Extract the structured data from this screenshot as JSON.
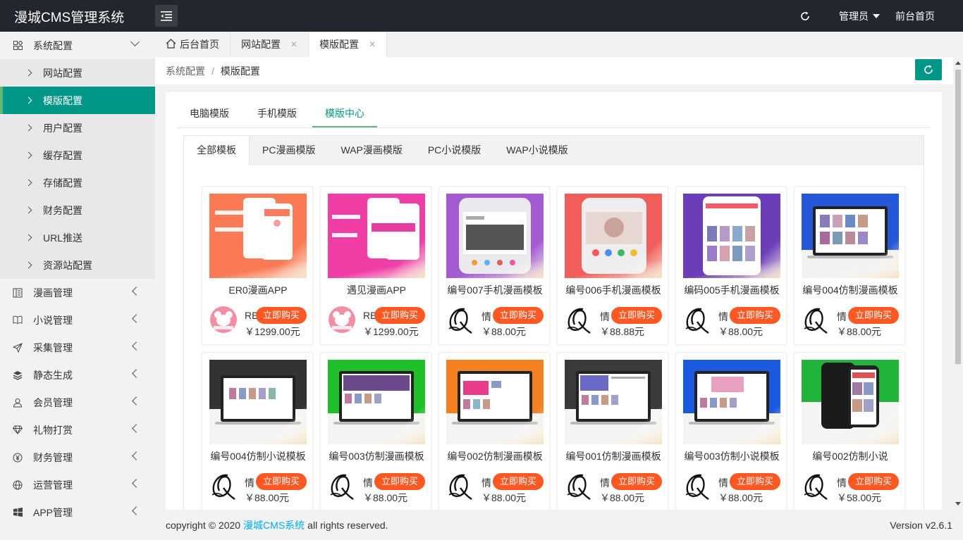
{
  "app": {
    "title": "漫城CMS管理系统"
  },
  "topbar": {
    "admin_label": "管理员",
    "front_link": "前台首页"
  },
  "sidebar": {
    "config_group": {
      "label": "系统配置",
      "icon": "grid-icon"
    },
    "config_items": [
      {
        "label": "网站配置"
      },
      {
        "label": "模版配置"
      },
      {
        "label": "用户配置"
      },
      {
        "label": "缓存配置"
      },
      {
        "label": "存储配置"
      },
      {
        "label": "财务配置"
      },
      {
        "label": "URL推送"
      },
      {
        "label": "资源站配置"
      }
    ],
    "groups": [
      {
        "label": "漫画管理",
        "icon": "comic-icon"
      },
      {
        "label": "小说管理",
        "icon": "book-icon"
      },
      {
        "label": "采集管理",
        "icon": "send-icon"
      },
      {
        "label": "静态生成",
        "icon": "layers-icon"
      },
      {
        "label": "会员管理",
        "icon": "user-icon"
      },
      {
        "label": "礼物打赏",
        "icon": "diamond-icon"
      },
      {
        "label": "财务管理",
        "icon": "yen-icon"
      },
      {
        "label": "运营管理",
        "icon": "globe-icon"
      },
      {
        "label": "APP管理",
        "icon": "windows-icon"
      }
    ]
  },
  "tabs": [
    {
      "label": "后台首页"
    },
    {
      "label": "网站配置"
    },
    {
      "label": "模版配置"
    }
  ],
  "breadcrumb": {
    "parent": "系统配置",
    "separator": "/",
    "current": "模版配置"
  },
  "main_tabs": [
    {
      "label": "电脑模版"
    },
    {
      "label": "手机模版"
    },
    {
      "label": "模版中心"
    }
  ],
  "inner_tabs": [
    {
      "label": "全部模板"
    },
    {
      "label": "PC漫画模版"
    },
    {
      "label": "WAP漫画模版"
    },
    {
      "label": "PC小说模版"
    },
    {
      "label": "WAP小说模版"
    }
  ],
  "buy_label": "立即购买",
  "templates": [
    {
      "name": "ER0漫画APP",
      "author": "RE",
      "price": "￥1299.00元",
      "thumb": "app-orange"
    },
    {
      "name": "遇见漫画APP",
      "author": "RE",
      "price": "￥1299.00元",
      "thumb": "app-pink"
    },
    {
      "name": "编号007手机漫画模板",
      "author": "情",
      "price": "￥88.00元",
      "thumb": "phone-purple"
    },
    {
      "name": "编号006手机漫画模板",
      "author": "情",
      "price": "￥88.88元",
      "thumb": "phone-red"
    },
    {
      "name": "编码005手机漫画模板",
      "author": "情",
      "price": "￥88.00元",
      "thumb": "phone-violet"
    },
    {
      "name": "编号004仿制漫画模板",
      "author": "情",
      "price": "￥88.00元",
      "thumb": "laptop-blue"
    },
    {
      "name": "编号004仿制小说模板",
      "author": "情",
      "price": "￥88.00元",
      "thumb": "laptop-dark"
    },
    {
      "name": "编号003仿制漫画模板",
      "author": "情",
      "price": "￥88.00元",
      "thumb": "laptop-green"
    },
    {
      "name": "编号002仿制漫画模板",
      "author": "情",
      "price": "￥88.00元",
      "thumb": "laptop-orange"
    },
    {
      "name": "编号001仿制漫画模板",
      "author": "情",
      "price": "￥88.00元",
      "thumb": "laptop-grey"
    },
    {
      "name": "编号003仿制小说模板",
      "author": "情",
      "price": "￥88.00元",
      "thumb": "laptop-blue2"
    },
    {
      "name": "编号002仿制小说",
      "author": "情",
      "price": "￥58.00元",
      "thumb": "phone-black"
    }
  ],
  "footer": {
    "prefix": "copyright © 2020",
    "brand": "漫城CMS系统",
    "suffix": "all rights reserved.",
    "version": "Version v2.6.1"
  },
  "colors": {
    "accent": "#009688",
    "topbar": "#23262e",
    "buy": "#ff5722",
    "link": "#01aaed"
  }
}
